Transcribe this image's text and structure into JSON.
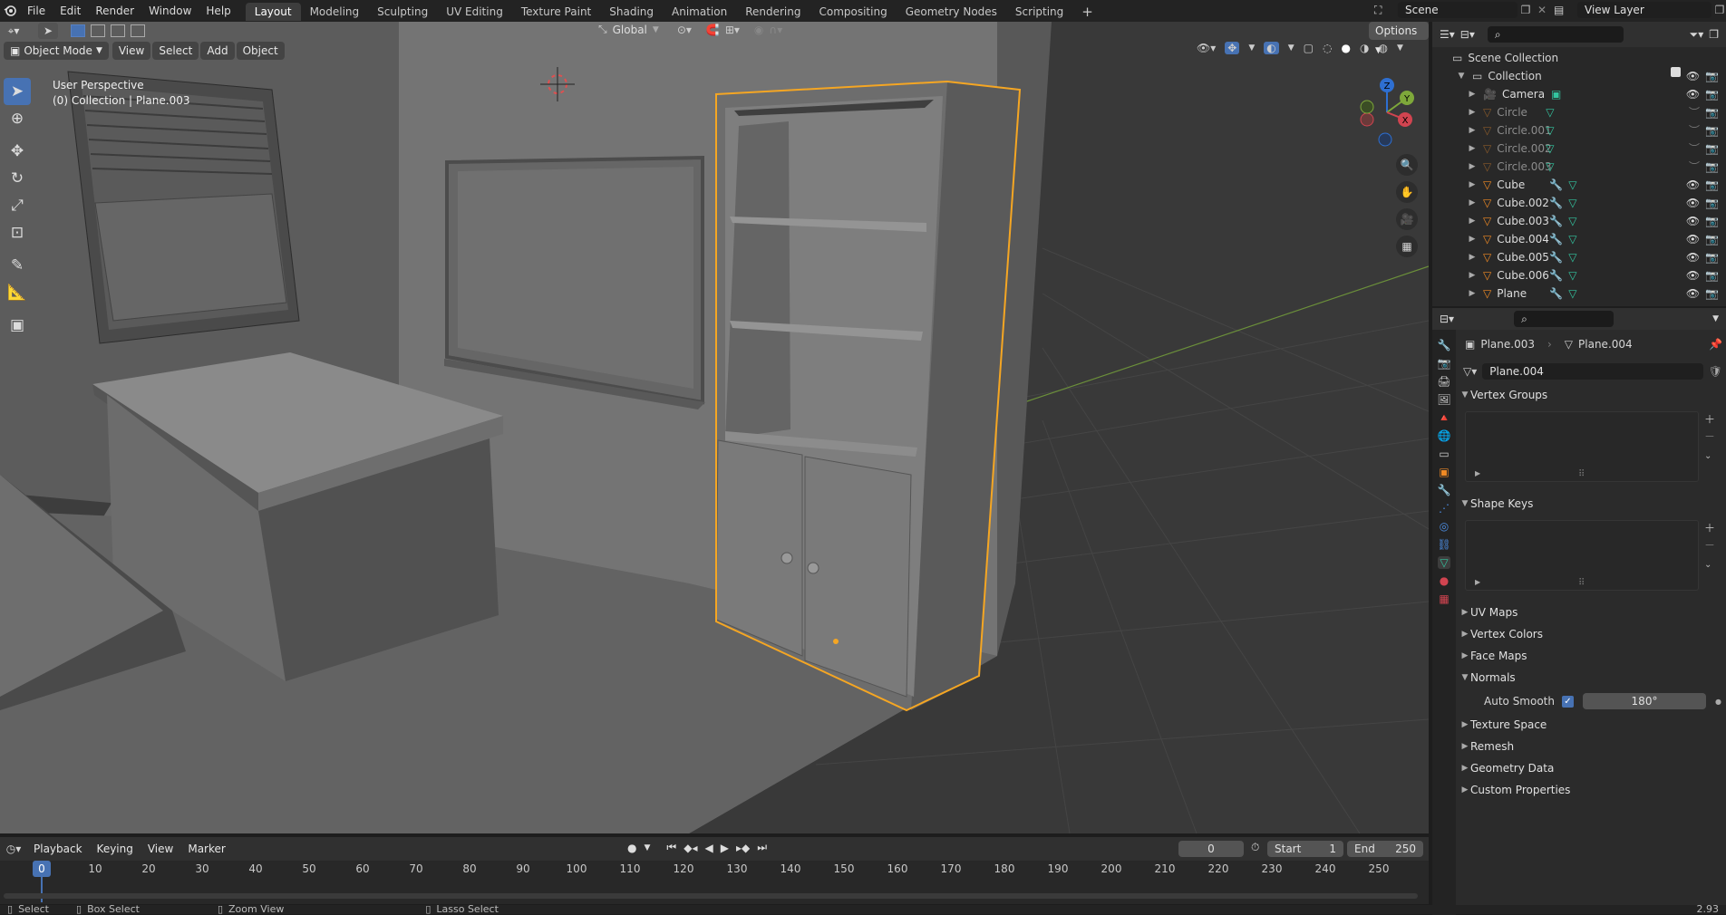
{
  "topbar": {
    "menus": [
      "File",
      "Edit",
      "Render",
      "Window",
      "Help"
    ],
    "workspaces": [
      "Layout",
      "Modeling",
      "Sculpting",
      "UV Editing",
      "Texture Paint",
      "Shading",
      "Animation",
      "Rendering",
      "Compositing",
      "Geometry Nodes",
      "Scripting"
    ],
    "active_workspace": "Layout",
    "add_tab": "+",
    "scene": "Scene",
    "view_layer": "View Layer"
  },
  "viewport": {
    "mode": "Object Mode",
    "menus": [
      "View",
      "Select",
      "Add",
      "Object"
    ],
    "transform_orientation": "Global",
    "options_label": "Options",
    "perspective_label": "User Perspective",
    "collection_label": "(0) Collection | Plane.003",
    "gizmo_axes": {
      "x": "X",
      "y": "Y",
      "z": "Z"
    }
  },
  "outliner": {
    "root": "Scene Collection",
    "collection": "Collection",
    "items": [
      {
        "name": "Camera",
        "dim": false,
        "modifier": false
      },
      {
        "name": "Circle",
        "dim": true,
        "modifier": false
      },
      {
        "name": "Circle.001",
        "dim": true,
        "modifier": false
      },
      {
        "name": "Circle.002",
        "dim": true,
        "modifier": false
      },
      {
        "name": "Circle.003",
        "dim": true,
        "modifier": false
      },
      {
        "name": "Cube",
        "dim": false,
        "modifier": true
      },
      {
        "name": "Cube.002",
        "dim": false,
        "modifier": true
      },
      {
        "name": "Cube.003",
        "dim": false,
        "modifier": true
      },
      {
        "name": "Cube.004",
        "dim": false,
        "modifier": true
      },
      {
        "name": "Cube.005",
        "dim": false,
        "modifier": true
      },
      {
        "name": "Cube.006",
        "dim": false,
        "modifier": true
      },
      {
        "name": "Plane",
        "dim": false,
        "modifier": true
      }
    ]
  },
  "properties": {
    "breadcrumb_object": "Plane.003",
    "breadcrumb_data": "Plane.004",
    "mesh_name": "Plane.004",
    "panels": {
      "vertex_groups": "Vertex Groups",
      "shape_keys": "Shape Keys",
      "uv_maps": "UV Maps",
      "vertex_colors": "Vertex Colors",
      "face_maps": "Face Maps",
      "normals": "Normals",
      "texture_space": "Texture Space",
      "remesh": "Remesh",
      "geometry_data": "Geometry Data",
      "custom_properties": "Custom Properties"
    },
    "auto_smooth_label": "Auto Smooth",
    "auto_smooth_checked": true,
    "auto_smooth_angle": "180°"
  },
  "timeline": {
    "menus": [
      "Playback",
      "Keying",
      "View",
      "Marker"
    ],
    "current_frame": "0",
    "start_label": "Start",
    "start_value": "1",
    "end_label": "End",
    "end_value": "250",
    "ticks": [
      "0",
      "10",
      "20",
      "30",
      "40",
      "50",
      "60",
      "70",
      "80",
      "90",
      "100",
      "110",
      "120",
      "130",
      "140",
      "150",
      "160",
      "170",
      "180",
      "190",
      "200",
      "210",
      "220",
      "230",
      "240",
      "250"
    ]
  },
  "statusbar": {
    "select": "Select",
    "box_select": "Box Select",
    "zoom_view": "Zoom View",
    "lasso_select": "Lasso Select",
    "version": "2.93"
  },
  "colors": {
    "accent": "#4772b3",
    "selection_outline": "#f5a623",
    "header_bg": "#303030",
    "viewport_bg": "#3a3a3a"
  }
}
